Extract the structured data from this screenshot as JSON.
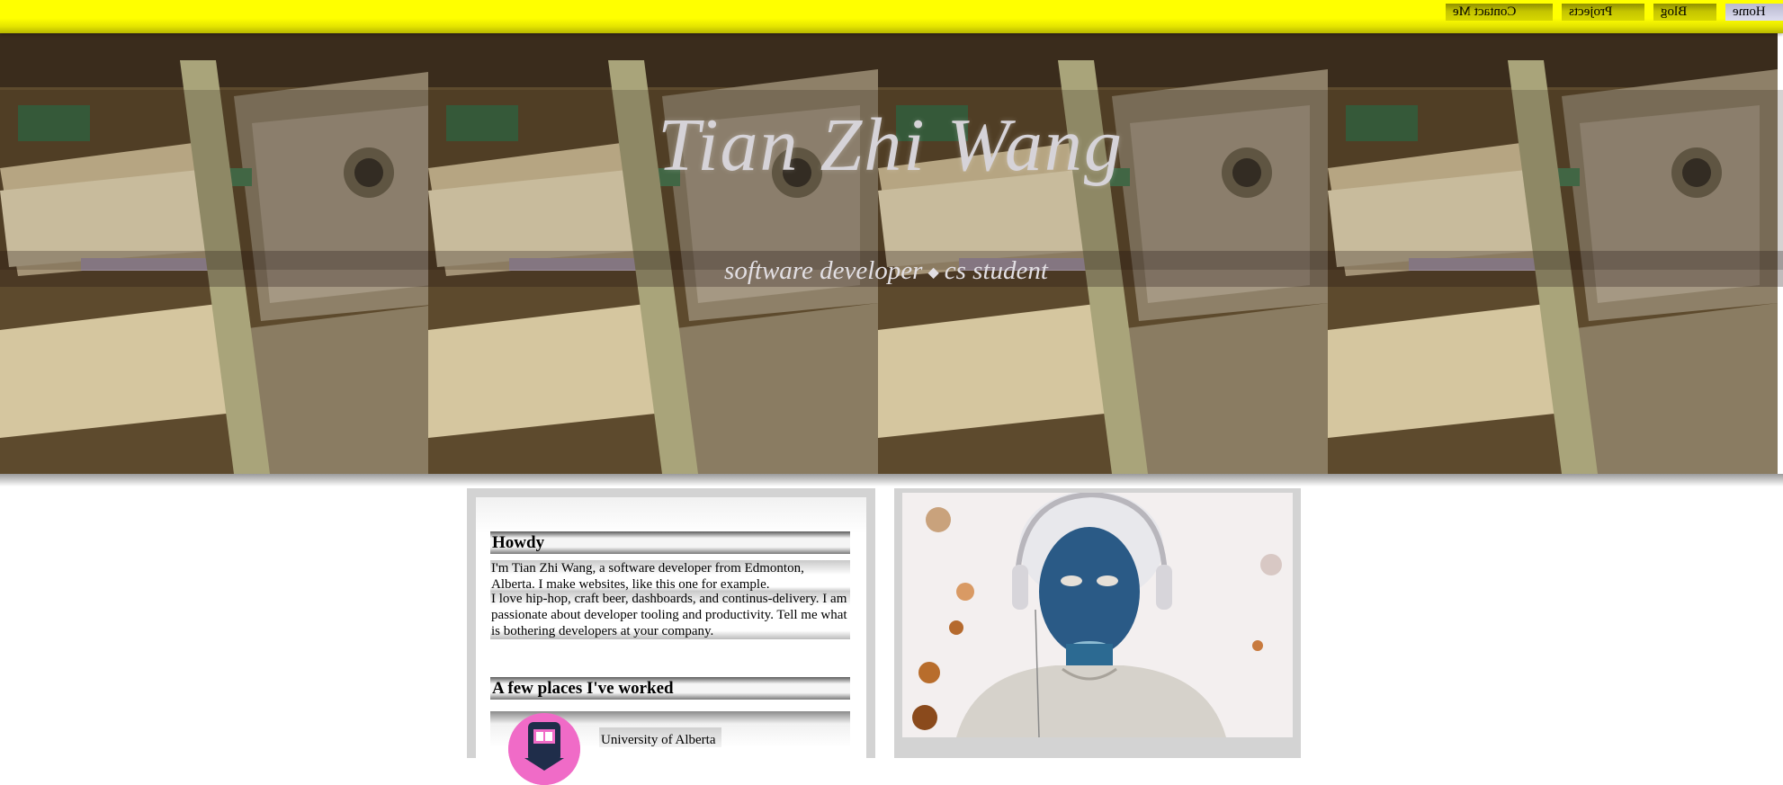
{
  "nav": {
    "items": [
      {
        "label": "Home",
        "active": true
      },
      {
        "label": "Blog",
        "active": false
      },
      {
        "label": "Projects",
        "active": false
      },
      {
        "label": "Contact Me",
        "active": false
      }
    ]
  },
  "hero": {
    "title": "Tian Zhi Wang",
    "subtitle_left": "software developer",
    "subtitle_sep": "◆",
    "subtitle_right": "cs student"
  },
  "about": {
    "heading": "Howdy",
    "para1": "I'm Tian Zhi Wang, a software developer from Edmonton, Alberta. I make websites, like this one for example.",
    "para2": "I love hip-hop, craft beer, dashboards, and continus-delivery. I am passionate about developer tooling and productivity. Tell me what is bothering developers at your company.",
    "work_heading": "A few places I've worked",
    "jobs": [
      {
        "name": "University of Alberta",
        "icon": "university-logo-icon"
      }
    ]
  },
  "colors": {
    "nav_bar": "#ffff00",
    "nav_button": "#c4c400",
    "nav_active": "#dcdcef",
    "card": "#d3d3d3",
    "logo_bg": "#f06bc7"
  }
}
